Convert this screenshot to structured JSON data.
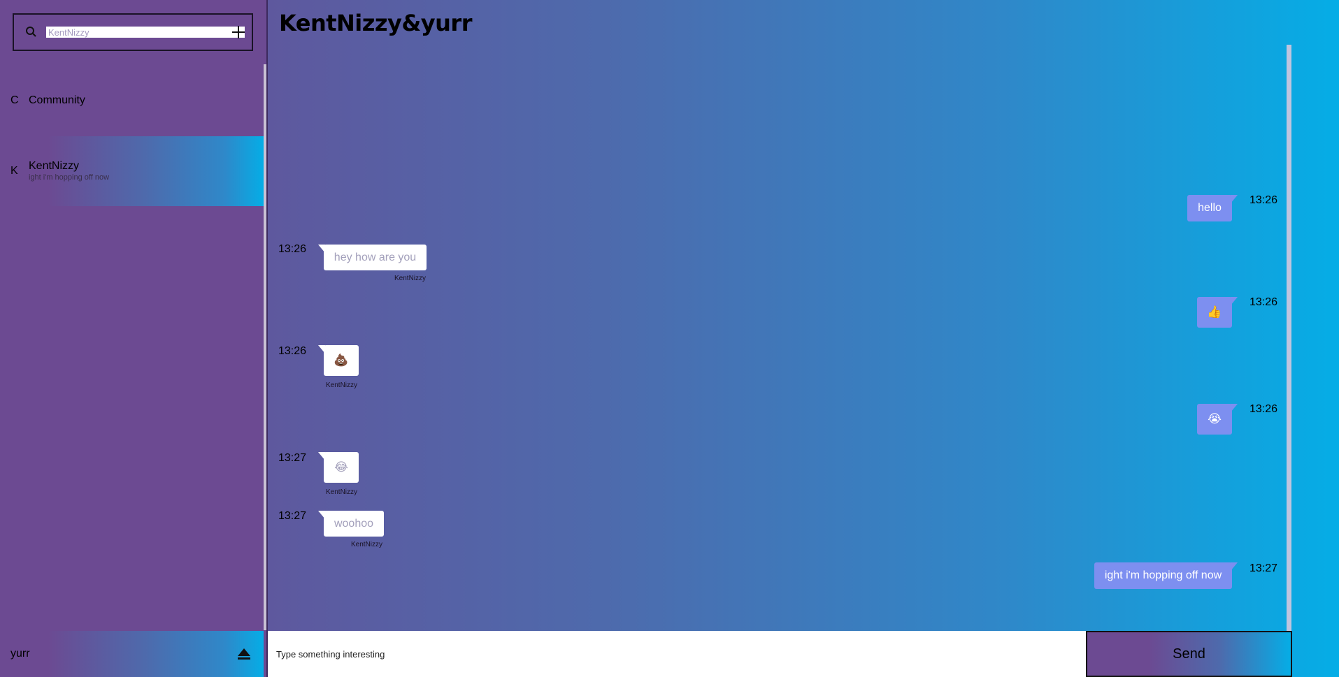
{
  "sidebar": {
    "search": {
      "placeholder": "KentNizzy"
    },
    "conversations": [
      {
        "initial": "C",
        "name": "Community"
      },
      {
        "initial": "K",
        "name": "KentNizzy",
        "preview": "ight i'm hopping off now"
      }
    ],
    "user": {
      "name": "yurr"
    }
  },
  "chat": {
    "title": "KentNizzy&yurr",
    "messages": [
      {
        "direction": "out",
        "time": "13:26",
        "text": "hello"
      },
      {
        "direction": "in",
        "time": "13:26",
        "text": "hey how are you",
        "sender": "KentNizzy"
      },
      {
        "direction": "out",
        "time": "13:26",
        "text": "👍"
      },
      {
        "direction": "in",
        "time": "13:26",
        "text": "💩",
        "sender": "KentNizzy"
      },
      {
        "direction": "out",
        "time": "13:26",
        "text": "😭"
      },
      {
        "direction": "in",
        "time": "13:27",
        "text": "😂",
        "sender": "KentNizzy"
      },
      {
        "direction": "in",
        "time": "13:27",
        "text": "woohoo",
        "sender": "KentNizzy"
      },
      {
        "direction": "out",
        "time": "13:27",
        "text": "ight i'm hopping off now"
      }
    ]
  },
  "composer": {
    "placeholder": "Type something interesting",
    "send_label": "Send"
  }
}
